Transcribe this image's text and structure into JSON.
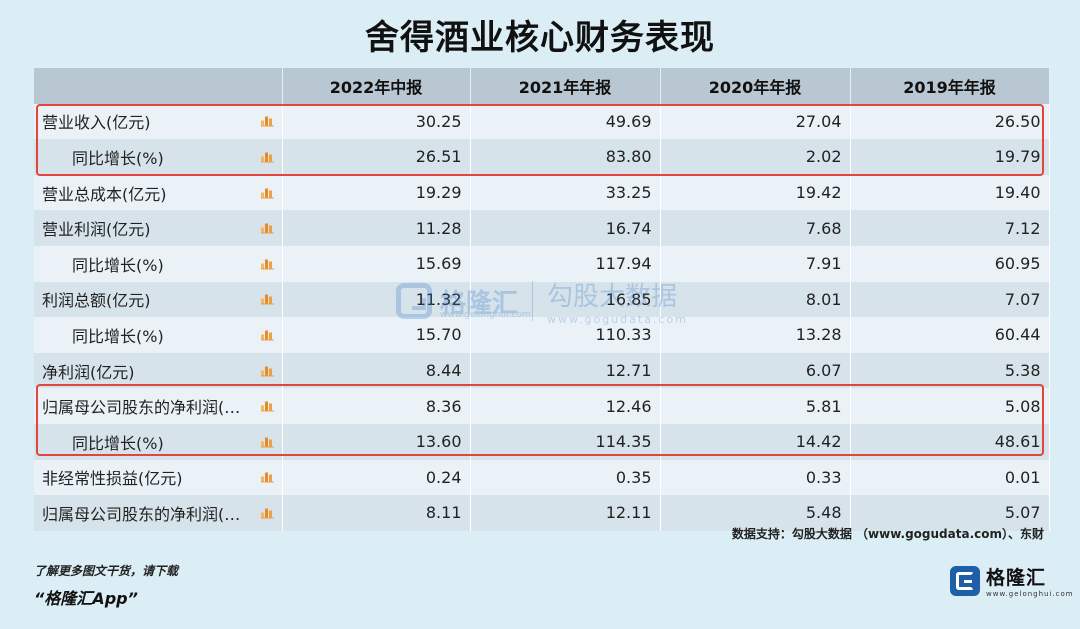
{
  "title": "舍得酒业核心财务表现",
  "header": [
    "",
    "2022年中报",
    "2021年年报",
    "2020年年报",
    "2019年年报"
  ],
  "rows": [
    {
      "label": "营业收入(亿元)",
      "indent": false,
      "values": [
        "30.25",
        "49.69",
        "27.04",
        "26.50"
      ]
    },
    {
      "label": "同比增长(%)",
      "indent": true,
      "values": [
        "26.51",
        "83.80",
        "2.02",
        "19.79"
      ]
    },
    {
      "label": "营业总成本(亿元)",
      "indent": false,
      "values": [
        "19.29",
        "33.25",
        "19.42",
        "19.40"
      ]
    },
    {
      "label": "营业利润(亿元)",
      "indent": false,
      "values": [
        "11.28",
        "16.74",
        "7.68",
        "7.12"
      ]
    },
    {
      "label": "同比增长(%)",
      "indent": true,
      "values": [
        "15.69",
        "117.94",
        "7.91",
        "60.95"
      ]
    },
    {
      "label": "利润总额(亿元)",
      "indent": false,
      "values": [
        "11.32",
        "16.85",
        "8.01",
        "7.07"
      ]
    },
    {
      "label": "同比增长(%)",
      "indent": true,
      "values": [
        "15.70",
        "110.33",
        "13.28",
        "60.44"
      ]
    },
    {
      "label": "净利润(亿元)",
      "indent": false,
      "values": [
        "8.44",
        "12.71",
        "6.07",
        "5.38"
      ]
    },
    {
      "label": "归属母公司股东的净利润(…",
      "indent": false,
      "values": [
        "8.36",
        "12.46",
        "5.81",
        "5.08"
      ]
    },
    {
      "label": "同比增长(%)",
      "indent": true,
      "values": [
        "13.60",
        "114.35",
        "14.42",
        "48.61"
      ]
    },
    {
      "label": "非经常性损益(亿元)",
      "indent": false,
      "values": [
        "0.24",
        "0.35",
        "0.33",
        "0.01"
      ]
    },
    {
      "label": "归属母公司股东的净利润(…",
      "indent": false,
      "values": [
        "8.11",
        "12.11",
        "5.48",
        "5.07"
      ]
    }
  ],
  "watermark": {
    "name": "格隆汇",
    "url": "www.gelonghui.com",
    "right_big": "勾股大数据",
    "right_small": "www.gogudata.com"
  },
  "source": "数据支持：勾股大数据 （www.gogudata.com）、东财",
  "promo_line1": "了解更多图文干货，请下载",
  "promo_line2": "“格隆汇App”",
  "brand_name": "格隆汇",
  "brand_url": "www.gelonghui.com",
  "icon_name": "bar-chart-icon",
  "highlight_color": "#e0453e"
}
